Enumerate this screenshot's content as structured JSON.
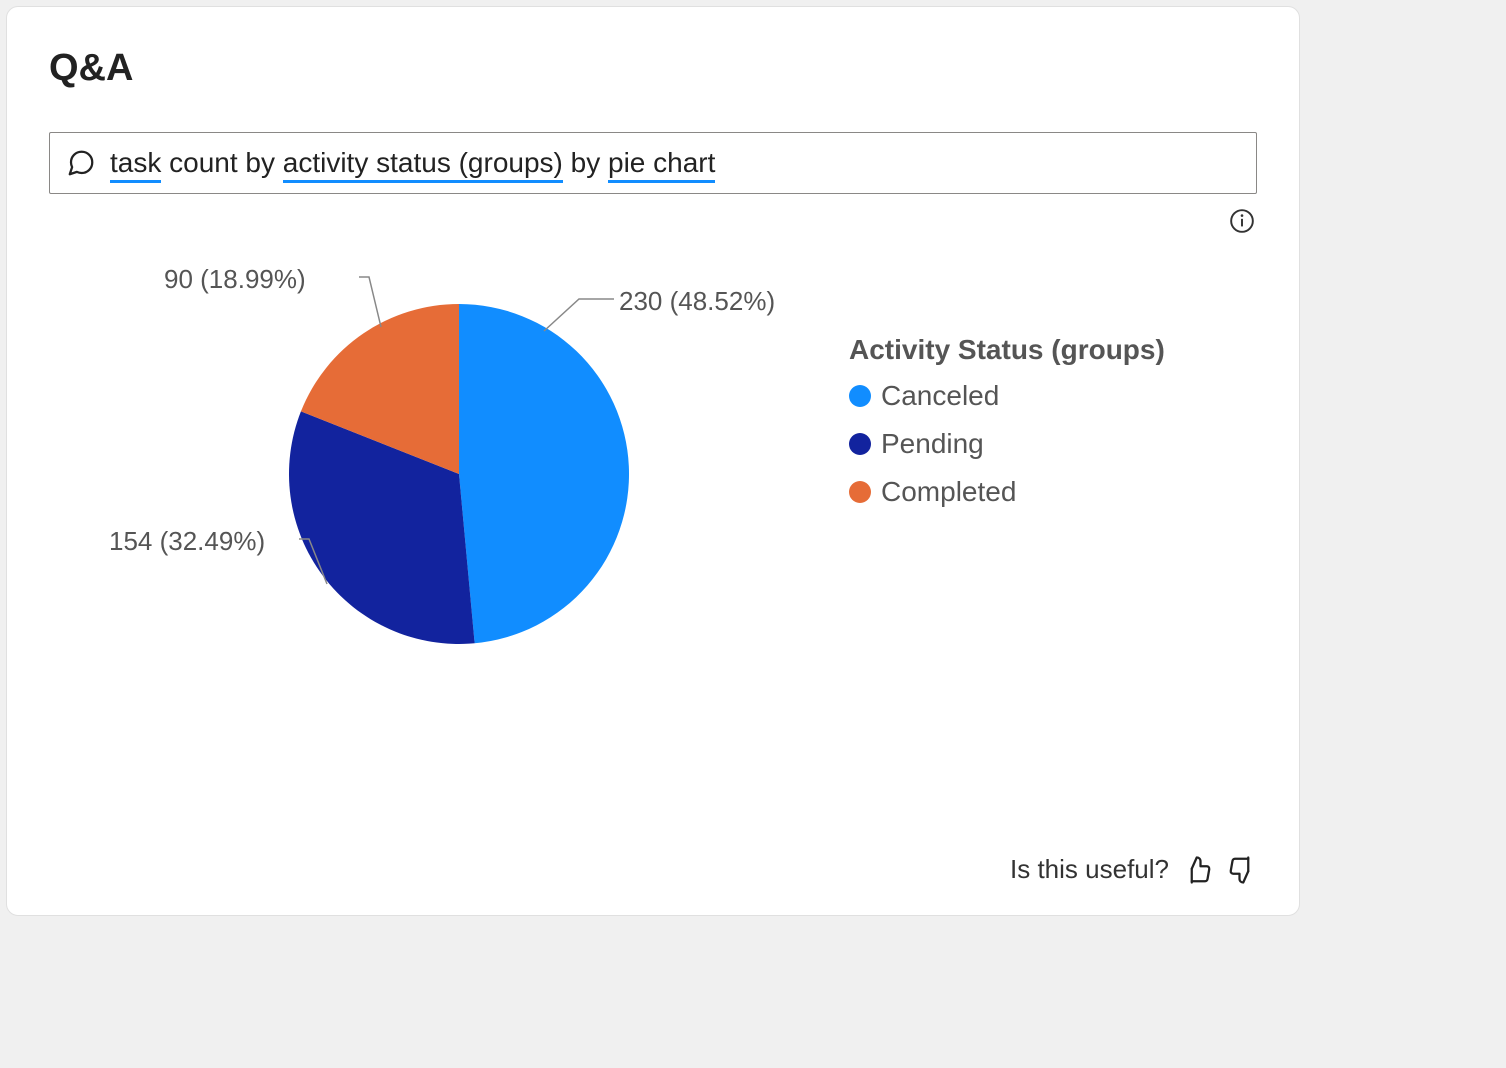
{
  "title": "Q&A",
  "query": {
    "prefix": "task",
    "mid1": " count by ",
    "term2": "activity status (groups)",
    "mid2": " by ",
    "term3": "pie chart"
  },
  "chart_data": {
    "type": "pie",
    "title": "",
    "legend_title": "Activity Status (groups)",
    "series": [
      {
        "name": "Canceled",
        "value": 230,
        "percent": 48.52,
        "color": "#118dff",
        "label": "230 (48.52%)"
      },
      {
        "name": "Pending",
        "value": 154,
        "percent": 32.49,
        "color": "#12239e",
        "label": "154 (32.49%)"
      },
      {
        "name": "Completed",
        "value": 90,
        "percent": 18.99,
        "color": "#e66c37",
        "label": "90 (18.99%)"
      }
    ]
  },
  "feedback_prompt": "Is this useful?"
}
